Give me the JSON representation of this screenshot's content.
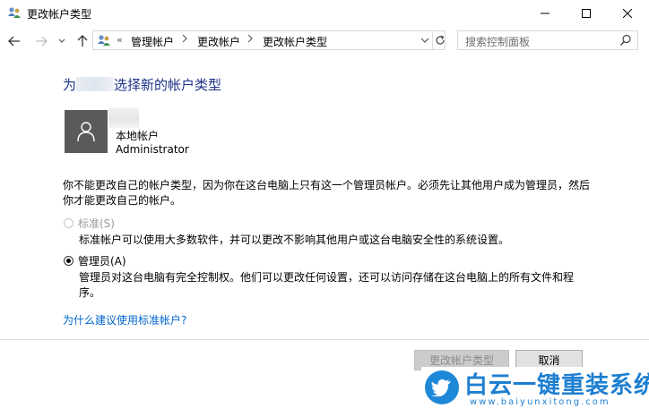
{
  "window": {
    "title": "更改帐户类型",
    "icons": {
      "app": "users-icon",
      "minimize": "minimize-icon",
      "maximize": "maximize-icon",
      "close": "close-icon"
    }
  },
  "nav": {
    "icons": {
      "back": "arrow-left-icon",
      "forward": "arrow-right-icon",
      "recent": "chevron-down-icon",
      "up": "arrow-up-icon"
    }
  },
  "address": {
    "overflow": "«",
    "crumbs": [
      "管理帐户",
      "更改帐户",
      "更改帐户类型"
    ],
    "icons": {
      "location": "users-icon",
      "separator": "chevron-right-icon",
      "dropdown": "chevron-down-icon",
      "refresh": "refresh-icon"
    }
  },
  "search": {
    "placeholder": "搜索控制面板",
    "icon": "search-icon"
  },
  "main": {
    "title_prefix": "为",
    "title_suffix": "选择新的帐户类型",
    "account": {
      "type": "本地帐户",
      "role": "Administrator",
      "avatar_icon": "user-icon"
    },
    "notice": "你不能更改自己的帐户类型，因为你在这台电脑上只有这一个管理员帐户。必须先让其他用户成为管理员，然后你才能更改自己的帐户。",
    "options": {
      "standard": {
        "label": "标准(S)",
        "description": "标准帐户可以使用大多数软件，并可以更改不影响其他用户或这台电脑安全性的系统设置。",
        "selected": false,
        "enabled": false
      },
      "admin": {
        "label": "管理员(A)",
        "description": "管理员对这台电脑有完全控制权。他们可以更改任何设置，还可以访问存储在这台电脑上的所有文件和程序。",
        "selected": true,
        "enabled": true
      }
    },
    "help_link": "为什么建议使用标准帐户?"
  },
  "buttons": {
    "change": "更改帐户类型",
    "cancel": "取消"
  },
  "watermark": {
    "title": "白云一键重装系统",
    "url": "www.baiyunxitong.com",
    "icon": "bird-icon"
  },
  "colors": {
    "title": "#1e3287",
    "link": "#0066cc",
    "watermark": "#1e7fd0"
  }
}
